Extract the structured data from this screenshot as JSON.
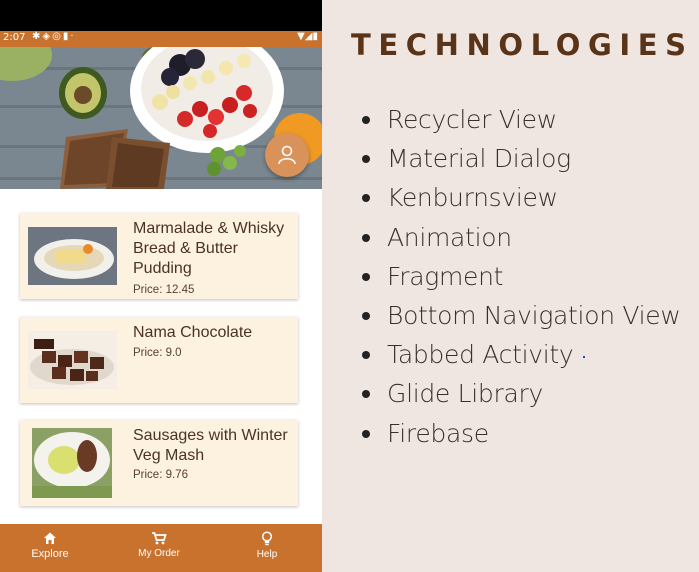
{
  "status_bar": {
    "time": "2:07",
    "icons": [
      "gear-icon",
      "shield-icon",
      "circle-a-icon",
      "sim-icon",
      "dot-icon"
    ],
    "right_icons": [
      "wifi-icon",
      "signal-icon",
      "battery-icon"
    ]
  },
  "menu_items": [
    {
      "title": "Marmalade & Whisky Bread & Butter Pudding",
      "price": "Price: 12.45"
    },
    {
      "title": "Nama Chocolate",
      "price": "Price: 9.0"
    },
    {
      "title": "Sausages with Winter Veg Mash",
      "price": "Price: 9.76"
    }
  ],
  "bottom_nav": [
    {
      "label": "Explore",
      "icon": "home-icon"
    },
    {
      "label": "My Order",
      "icon": "cart-icon"
    },
    {
      "label": "Help",
      "icon": "lightbulb-icon"
    }
  ],
  "technologies": {
    "heading": "TECHNOLOGIES",
    "items": [
      "Recycler View",
      "Material Dialog",
      "Kenburnsview",
      "Animation",
      "Fragment",
      "Bottom Navigation View",
      "Tabbed Activity",
      "Glide Library",
      "Firebase"
    ]
  },
  "colors": {
    "accent": "#c9722e",
    "card": "#fdf2e0",
    "heading": "#5a3418",
    "panel": "#efe6e1"
  }
}
